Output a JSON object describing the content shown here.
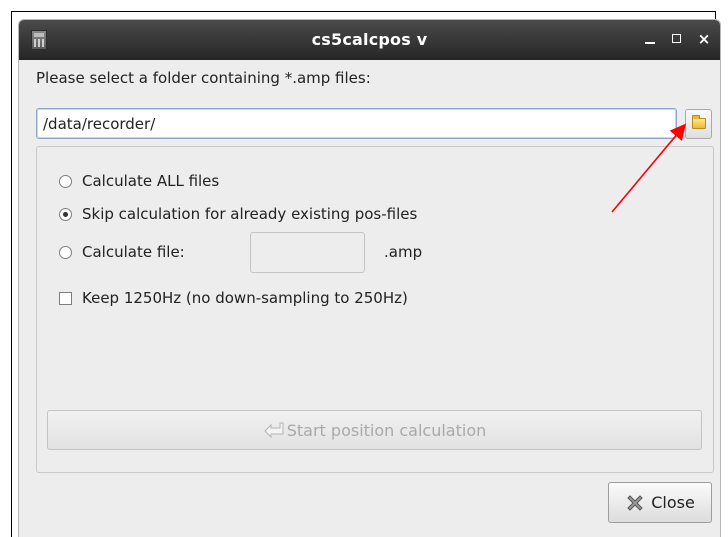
{
  "window": {
    "title": "cs5calcpos v"
  },
  "prompt": "Please select a folder containing *.amp files:",
  "folder_input": {
    "value": "/data/recorder/"
  },
  "options": {
    "calc_all": "Calculate ALL files",
    "skip_existing": "Skip calculation for already existing pos-files",
    "calc_file": "Calculate file:",
    "file_value": "",
    "amp_suffix": ".amp",
    "selected": "skip_existing",
    "keep_1250": "Keep 1250Hz (no down-sampling to 250Hz)",
    "keep_1250_checked": false
  },
  "buttons": {
    "start": "Start position calculation",
    "start_enabled": false,
    "close": "Close"
  },
  "icons": {
    "app": "app-icon",
    "browse": "folder-icon",
    "start": "arrow-icon",
    "close": "close-icon"
  },
  "colors": {
    "titlebar": "#2f2f2f",
    "window_bg": "#ededed",
    "annotation_arrow": "#ff0000"
  }
}
